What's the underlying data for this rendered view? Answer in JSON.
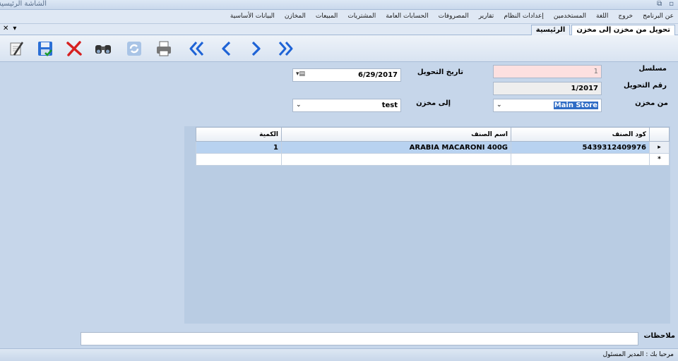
{
  "window": {
    "title": "الشاشة الرئيسية",
    "controls": [
      "⧉",
      "▫"
    ]
  },
  "menu": [
    "البيانات الأساسية",
    "المخازن",
    "المبيعات",
    "المشتريات",
    "الحسابات العامة",
    "المصروفات",
    "تقارير",
    "إعدادات النظام",
    "المستخدمين",
    "اللغة",
    "خروج",
    "عن البرنامج"
  ],
  "tabs": {
    "items": [
      "تحويل من مخزن إلى مخزن",
      "الرئيسية"
    ],
    "controls": [
      "✕",
      "▾"
    ]
  },
  "toolbar": {
    "icons": [
      "new-icon",
      "save-icon",
      "delete-icon",
      "search-icon",
      "refresh-icon",
      "print-icon",
      "first-icon",
      "previous-icon",
      "next-icon",
      "last-icon"
    ],
    "colors": {
      "nav": "#1e63d6",
      "delete": "#d62020",
      "save": "#2b6fd6"
    }
  },
  "form": {
    "serial_label": "مسلسل",
    "serial_value": "1",
    "date_label": "تاريخ التحويل",
    "date_value": "6/29/2017",
    "transfer_no_label": "رقم التحويل",
    "transfer_no_value": "1/2017",
    "from_store_label": "من مخزن",
    "from_store_value": "Main Store",
    "to_store_label": "إلى مخزن",
    "to_store_value": "test"
  },
  "grid": {
    "columns": [
      "كود الصنف",
      "اسم الصنف",
      "الكمية"
    ],
    "rows": [
      {
        "indicator": "▸",
        "code": "5439312409976",
        "name": "ARABIA MACARONI 400G",
        "qty": "1"
      }
    ],
    "new_row_indicator": "*"
  },
  "notes": {
    "label": "ملاحظات",
    "value": ""
  },
  "status": {
    "text": "مرحبا بك :  المدير المسئول"
  }
}
